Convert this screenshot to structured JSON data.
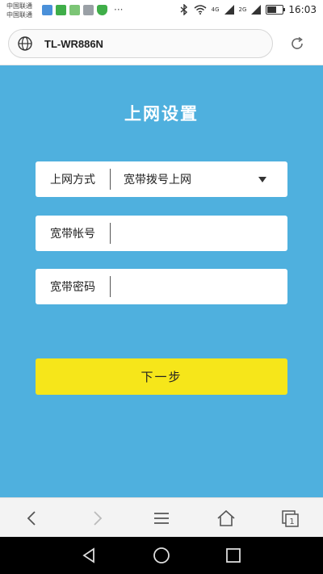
{
  "status_bar": {
    "carrier_lines": [
      "中国联通",
      "中国联通"
    ],
    "notification_icons": [
      "image-icon",
      "wechat-icon",
      "app-icon",
      "gallery-icon",
      "shield-icon"
    ],
    "more": "···",
    "signal_labels": [
      "4G",
      "2G"
    ],
    "battery_level_percent": 60,
    "time": "16:03"
  },
  "address_bar": {
    "url": "TL-WR886N",
    "icons": {
      "site": "globe-icon",
      "refresh": "refresh-icon"
    }
  },
  "page": {
    "background_color": "#4fb0de",
    "title": "上网设置",
    "connection_type": {
      "label": "上网方式",
      "value": "宽带拨号上网"
    },
    "account": {
      "label": "宽带帐号",
      "value": ""
    },
    "password": {
      "label": "宽带密码",
      "value": ""
    },
    "next_button": "下一步",
    "accent_color": "#f6e61a"
  },
  "browser_toolbar": {
    "icons": [
      "back-icon",
      "forward-icon",
      "menu-icon",
      "home-icon",
      "tabs-icon"
    ],
    "tab_count": "1"
  },
  "nav_bar": {
    "icons": [
      "nav-back-icon",
      "nav-home-icon",
      "nav-recents-icon"
    ]
  }
}
